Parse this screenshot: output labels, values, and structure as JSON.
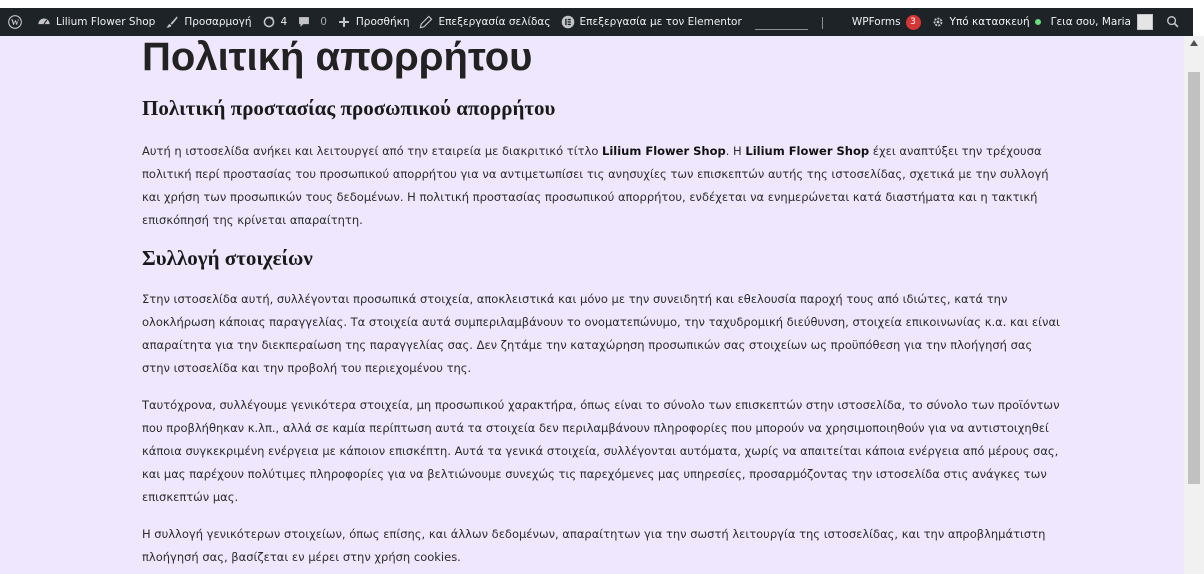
{
  "adminbar": {
    "site_name": "Lilium Flower Shop",
    "customize": "Προσαρμογή",
    "updates_count": "4",
    "comments_count": "0",
    "new": "Προσθήκη",
    "edit_page": "Επεξεργασία σελίδας",
    "edit_elementor": "Επεξεργασία με τον Elementor",
    "wpforms": "WPForms",
    "wpforms_badge": "3",
    "maintenance": "Υπό κατασκευή",
    "greeting": "Γεια σου, Maria"
  },
  "content": {
    "title": "Πολιτική απορρήτου",
    "section1_heading": "Πολιτική προστασίας προσωπικού απορρήτου",
    "p1": {
      "text_a": "Αυτή η ιστοσελίδα ανήκει και λειτουργεί από την εταιρεία με διακριτικό τίτλο ",
      "brand_1": "Lilium Flower Shop",
      "text_b": ". Η ",
      "brand_2": "Lilium Flower Shop",
      "text_c": " έχει αναπτύξει την τρέχουσα πολιτική περί προστασίας του προσωπικού απορρήτου για να αντιμετωπίσει τις ανησυχίες των επισκεπτών αυτής της ιστοσελίδας, σχετικά με την συλλογή και χρήση των προσωπικών τους δεδομένων. Η πολιτική προστασίας προσωπικού απορρήτου, ενδέχεται να ενημερώνεται κατά διαστήματα και η τακτική επισκόπησή της κρίνεται απαραίτητη."
    },
    "section2_heading": "Συλλογή στοιχείων",
    "p2": "Στην ιστοσελίδα αυτή, συλλέγονται προσωπικά στοιχεία, αποκλειστικά και μόνο με την συνειδητή και εθελουσία παροχή τους από ιδιώτες, κατά την ολοκλήρωση κάποιας παραγγελίας. Τα στοιχεία αυτά συμπεριλαμβάνουν το ονοματεπώνυμο, την ταχυδρομική διεύθυνση, στοιχεία επικοινωνίας κ.α. και είναι απαραίτητα για την διεκπεραίωση της παραγγελίας σας. Δεν ζητάμε την καταχώρηση προσωπικών σας στοιχείων ως προϋπόθεση για την πλοήγησή σας στην ιστοσελίδα και την προβολή του περιεχομένου της.",
    "p3": "Ταυτόχρονα, συλλέγουμε γενικότερα στοιχεία, μη προσωπικού χαρακτήρα, όπως είναι το σύνολο των επισκεπτών στην ιστοσελίδα, το σύνολο των προϊόντων που προβλήθηκαν κ.λπ., αλλά σε καμία περίπτωση αυτά τα στοιχεία δεν περιλαμβάνουν πληροφορίες που μπορούν να χρησιμοποιηθούν για να αντιστοιχηθεί κάποια συγκεκριμένη ενέργεια με κάποιον επισκέπτη. Αυτά τα γενικά στοιχεία, συλλέγονται αυτόματα, χωρίς να απαιτείται κάποια ενέργεια από μέρους σας, και μας παρέχουν πολύτιμες πληροφορίες για να βελτιώνουμε συνεχώς τις παρεχόμενες μας υπηρεσίες, προσαρμόζοντας την ιστοσελίδα στις ανάγκες των επισκεπτών μας.",
    "p4": "Η συλλογή γενικότερων στοιχείων, όπως επίσης, και άλλων δεδομένων, απαραίτητων για την σωστή λειτουργία της ιστοσελίδας, και την απροβλημάτιστη πλοήγησή σας, βασίζεται εν μέρει στην χρήση cookies."
  },
  "colors": {
    "adminbar_bg": "#1d2327",
    "page_bg": "#efe7fd",
    "badge": "#d63638",
    "status_dot": "#68de7c"
  },
  "icons": [
    "wordpress-icon",
    "dashboard-icon",
    "brush-icon",
    "updates-icon",
    "comment-icon",
    "plus-icon",
    "pencil-icon",
    "elementor-icon",
    "gear-icon",
    "search-icon"
  ]
}
